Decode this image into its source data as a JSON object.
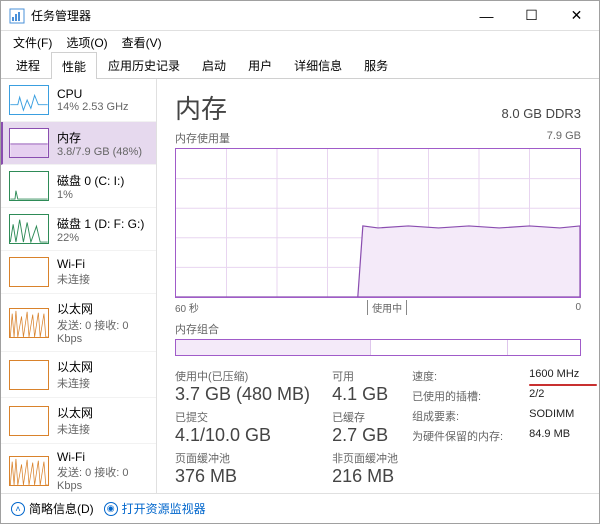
{
  "window": {
    "title": "任务管理器"
  },
  "menu": [
    "文件(F)",
    "选项(O)",
    "查看(V)"
  ],
  "tabs": [
    "进程",
    "性能",
    "应用历史记录",
    "启动",
    "用户",
    "详细信息",
    "服务"
  ],
  "active_tab": 1,
  "sidebar": {
    "items": [
      {
        "title": "CPU",
        "sub": "14% 2.53 GHz",
        "color": "#3a9fe0"
      },
      {
        "title": "内存",
        "sub": "3.8/7.9 GB (48%)",
        "color": "#8a4db0",
        "selected": true
      },
      {
        "title": "磁盘 0 (C: I:)",
        "sub": "1%",
        "color": "#2e8b57"
      },
      {
        "title": "磁盘 1 (D: F: G:)",
        "sub": "22%",
        "color": "#2e8b57"
      },
      {
        "title": "Wi-Fi",
        "sub": "未连接",
        "color": "#d9822b"
      },
      {
        "title": "以太网",
        "sub": "发送: 0 接收: 0 Kbps",
        "color": "#d9822b"
      },
      {
        "title": "以太网",
        "sub": "未连接",
        "color": "#d9822b"
      },
      {
        "title": "以太网",
        "sub": "未连接",
        "color": "#d9822b"
      },
      {
        "title": "Wi-Fi",
        "sub": "发送: 0 接收: 0 Kbps",
        "color": "#d9822b"
      }
    ]
  },
  "main": {
    "title": "内存",
    "spec": "8.0 GB DDR3",
    "usage_label": "内存使用量",
    "usage_max": "7.9 GB",
    "axis_left": "60 秒",
    "axis_mid": "使用中",
    "axis_right": "0",
    "comp_label": "内存组合",
    "stats_left": [
      {
        "label": "使用中(已压缩)",
        "value": "3.7 GB (480 MB)"
      },
      {
        "label": "可用",
        "value": "4.1 GB"
      },
      {
        "label": "已提交",
        "value": "4.1/10.0 GB"
      },
      {
        "label": "已缓存",
        "value": "2.7 GB"
      },
      {
        "label": "页面缓冲池",
        "value": "376 MB"
      },
      {
        "label": "非页面缓冲池",
        "value": "216 MB"
      }
    ],
    "stats_right": [
      {
        "label": "速度:",
        "value": "1600 MHz",
        "highlight": true
      },
      {
        "label": "已使用的插槽:",
        "value": "2/2"
      },
      {
        "label": "组成要素:",
        "value": "SODIMM"
      },
      {
        "label": "为硬件保留的内存:",
        "value": "84.9 MB"
      }
    ]
  },
  "footer": {
    "less": "简略信息(D)",
    "monitor": "打开资源监视器"
  },
  "chart_data": {
    "type": "area",
    "title": "内存使用量",
    "ylabel": "GB",
    "ylim": [
      0,
      7.9
    ],
    "x_range_seconds": 60,
    "series": [
      {
        "name": "使用中",
        "x": [
          0,
          5,
          10,
          15,
          20,
          25,
          27,
          28,
          30,
          35,
          40,
          45,
          50,
          55,
          60
        ],
        "values": [
          0,
          0,
          0,
          0,
          0,
          0,
          0,
          3.7,
          3.8,
          3.75,
          3.8,
          3.75,
          3.8,
          3.8,
          3.8
        ]
      }
    ],
    "composition": {
      "used_fraction": 0.48,
      "total_gb": 7.9
    }
  }
}
